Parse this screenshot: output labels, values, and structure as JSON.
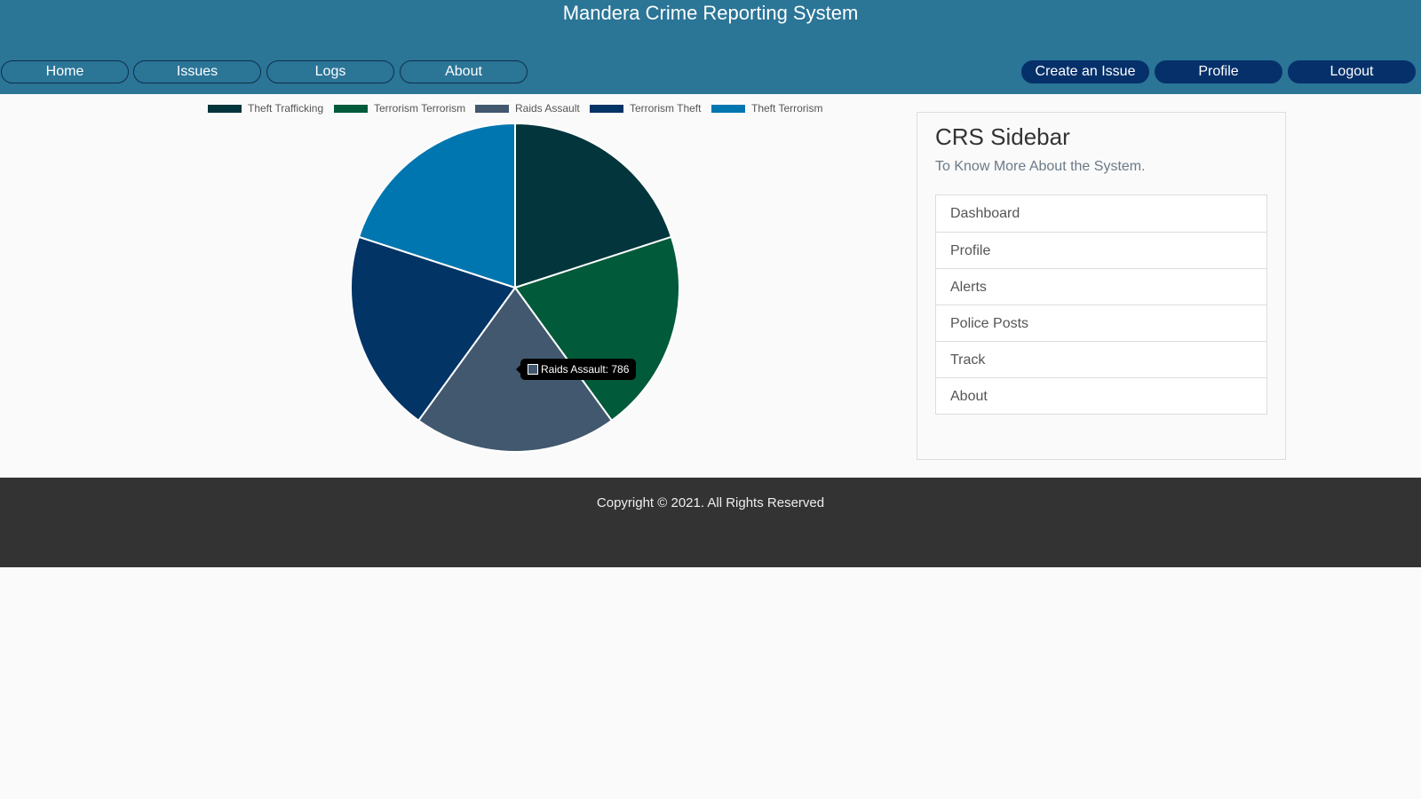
{
  "header": {
    "title": "Mandera Crime Reporting System",
    "nav_left": [
      "Home",
      "Issues",
      "Logs",
      "About"
    ],
    "nav_right": [
      "Create an Issue",
      "Profile",
      "Logout"
    ]
  },
  "chart_data": {
    "type": "pie",
    "categories": [
      "Theft Trafficking",
      "Terrorism Terrorism",
      "Raids Assault",
      "Terrorism Theft",
      "Theft Terrorism"
    ],
    "colors": [
      "#02353c",
      "#015a3a",
      "#41586e",
      "#033466",
      "#0076b0"
    ],
    "values": [
      786,
      786,
      786,
      786,
      786
    ],
    "legend_position": "top"
  },
  "tooltip": {
    "text": "Raids Assault: 786"
  },
  "sidebar": {
    "title": "CRS Sidebar",
    "subtitle": "To Know More About the System.",
    "items": [
      "Dashboard",
      "Profile",
      "Alerts",
      "Police Posts",
      "Track",
      "About"
    ]
  },
  "footer": {
    "copyright": "Copyright © 2021. All Rights Reserved"
  }
}
